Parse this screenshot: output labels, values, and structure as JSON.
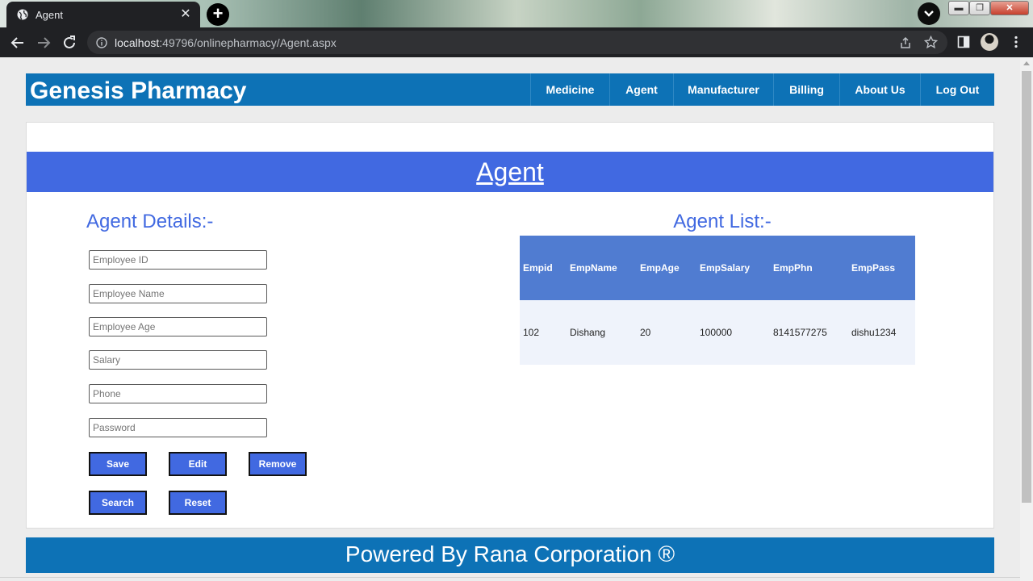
{
  "browser": {
    "tab_title": "Agent",
    "url_host": "localhost",
    "url_rest": ":49796/onlinepharmacy/Agent.aspx"
  },
  "site": {
    "brand": "Genesis Pharmacy",
    "nav": [
      "Medicine",
      "Agent",
      "Manufacturer",
      "Billing",
      "About Us",
      "Log Out"
    ],
    "page_title": "Agent",
    "footer": "Powered By Rana Corporation ®"
  },
  "form": {
    "heading": "Agent Details:-",
    "fields": [
      {
        "placeholder": "Employee ID",
        "value": ""
      },
      {
        "placeholder": "Employee Name",
        "value": ""
      },
      {
        "placeholder": "Employee Age",
        "value": ""
      },
      {
        "placeholder": "Salary",
        "value": ""
      },
      {
        "placeholder": "Phone",
        "value": ""
      },
      {
        "placeholder": "Password",
        "value": ""
      }
    ],
    "buttons": {
      "save": "Save",
      "edit": "Edit",
      "remove": "Remove",
      "search": "Search",
      "reset": "Reset"
    }
  },
  "list": {
    "heading": "Agent List:-",
    "columns": [
      "Empid",
      "EmpName",
      "EmpAge",
      "EmpSalary",
      "EmpPhn",
      "EmpPass"
    ],
    "rows": [
      [
        "102",
        "Dishang",
        "20",
        "100000",
        "8141577275",
        "dishu1234"
      ]
    ]
  },
  "colors": {
    "header_blue": "#0d72b6",
    "royal_blue": "#4169e1",
    "grid_header": "#507cd1",
    "grid_row": "#eff3fb"
  }
}
